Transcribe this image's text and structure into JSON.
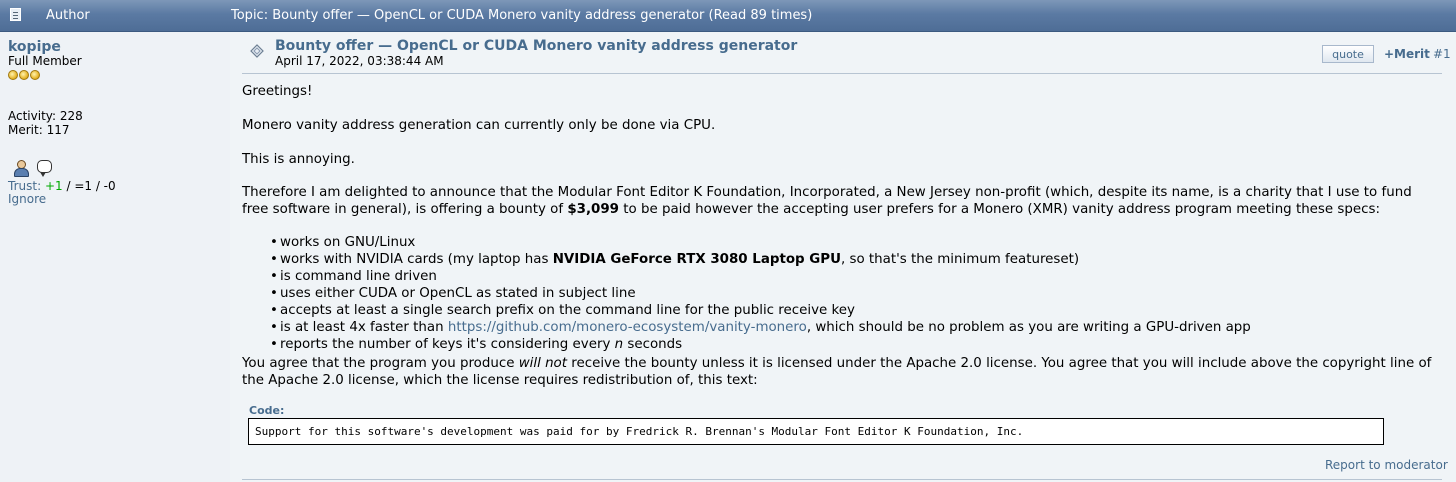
{
  "header": {
    "author_label": "Author",
    "topic_label": "Topic: Bounty offer — OpenCL or CUDA Monero vanity address generator  (Read 89 times)"
  },
  "poster": {
    "name": "kopipe",
    "rank": "Full Member",
    "stars": 3,
    "activity": "Activity: 228",
    "merit": "Merit: 117",
    "trust_label": "Trust:",
    "trust_pos": "+1",
    "trust_rest": " / =1 / -0",
    "ignore": "Ignore"
  },
  "post": {
    "title": "Bounty offer — OpenCL or CUDA Monero vanity address generator",
    "date": "April 17, 2022, 03:38:44 AM",
    "quote_label": "quote",
    "merit_label": "+Merit",
    "post_number": "#1",
    "greeting": "Greetings!",
    "line2": "Monero vanity address generation can currently only be done via CPU.",
    "line3": "This is annoying.",
    "p4_before": "Therefore I am delighted to announce that the Modular Font Editor K Foundation, Incorporated, a New Jersey non-profit (which, despite its name, is a charity that I use to fund free software in general), is offering a bounty of ",
    "p4_amount": "$3,099",
    "p4_after": " to be paid however the accepting user prefers for a Monero (XMR) vanity address program meeting these specs:",
    "spec_1": "works on GNU/Linux",
    "spec_2_before": "works with NVIDIA cards (my laptop has ",
    "spec_2_bold": "NVIDIA GeForce RTX 3080 Laptop GPU",
    "spec_2_after": ", so that's the minimum featureset)",
    "spec_3": "is command line driven",
    "spec_4": "uses either CUDA or OpenCL as stated in subject line",
    "spec_5": "accepts at least a single search prefix on the command line for the public receive key",
    "spec_6_before": "is at least 4x faster than ",
    "spec_6_link": "https://github.com/monero-ecosystem/vanity-monero",
    "spec_6_after": ", which should be no problem as you are writing a GPU-driven app",
    "spec_7_before": "reports the number of keys it's considering every ",
    "spec_7_italic": "n",
    "spec_7_after": " seconds",
    "p5_before": "You agree that the program you produce ",
    "p5_italic": "will not",
    "p5_after": " receive the bounty unless it is licensed under the Apache 2.0 license. You agree that you will include above the copyright line of the Apache 2.0 license, which the license requires redistribution of, this text:",
    "code_label": "Code:",
    "code_text": "Support for this software's development was paid for by Fredrick R. Brennan's Modular Font Editor K Foundation, Inc.",
    "report_label": "Report to moderator"
  }
}
